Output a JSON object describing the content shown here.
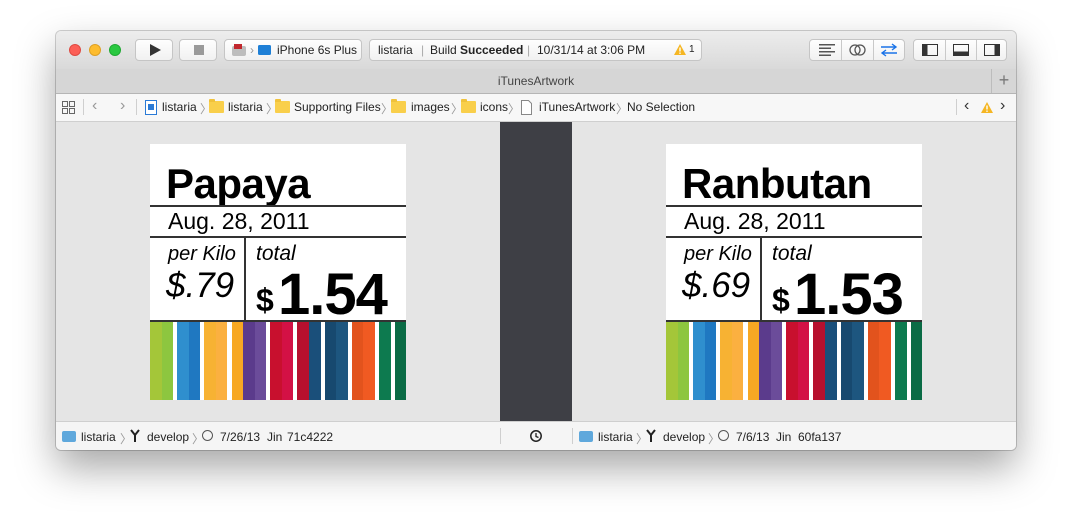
{
  "toolbar": {
    "scheme_name": "iPhone 6s Plus",
    "status_project": "listaria",
    "status_build_prefix": "Build ",
    "status_build_result": "Succeeded",
    "status_datetime": "10/31/14 at 3:06 PM",
    "warning_count": "1"
  },
  "tab": {
    "title": "iTunesArtwork",
    "add_label": "+"
  },
  "jumpbar": {
    "items": [
      "listaria",
      "listaria",
      "Supporting Files",
      "images",
      "icons",
      "iTunesArtwork",
      "No Selection"
    ]
  },
  "left_card": {
    "name": "Papaya",
    "date": "Aug. 28, 2011",
    "per_label": "per Kilo",
    "price": "$.79",
    "total_label": "total",
    "total_currency": "$",
    "total_value": "1.54"
  },
  "right_card": {
    "name": "Ranbutan",
    "date": "Aug. 28, 2011",
    "per_label": "per Kilo",
    "price": "$.69",
    "total_label": "total",
    "total_currency": "$",
    "total_value": "1.53"
  },
  "stripe_colors": [
    "#a4c639",
    "#8dc63f",
    "#ffffff",
    "#2f8fce",
    "#1f78c1",
    "#ffffff",
    "#f7b233",
    "#fbb040",
    "#ffffff",
    "#f7a823",
    "#5b3b8c",
    "#6b4c9a",
    "#ffffff",
    "#c8102e",
    "#d31145",
    "#ffffff",
    "#b7102e",
    "#1a4f7a",
    "#ffffff",
    "#17496f",
    "#1d567f",
    "#ffffff",
    "#e2531d",
    "#f05a22",
    "#ffffff",
    "#0d7a4f",
    "#ffffff",
    "#0a6b45"
  ],
  "bottom_left": {
    "repo": "listaria",
    "branch": "develop",
    "date": "7/26/13",
    "author": "Jin",
    "commit": "71c4222"
  },
  "bottom_right": {
    "repo": "listaria",
    "branch": "develop",
    "date": "7/6/13",
    "author": "Jin",
    "commit": "60fa137"
  }
}
